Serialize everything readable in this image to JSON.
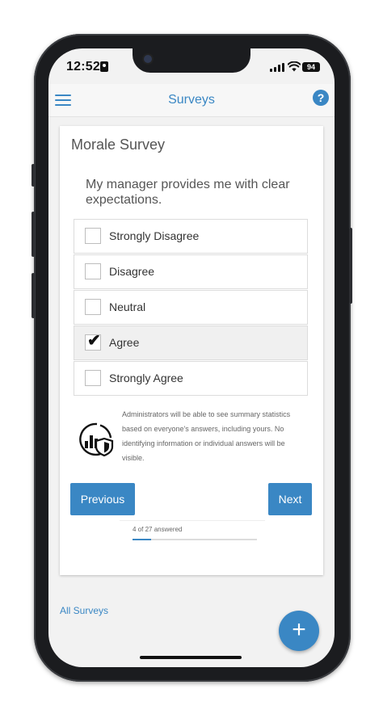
{
  "status_bar": {
    "time": "12:52",
    "battery": "94"
  },
  "header": {
    "title": "Surveys"
  },
  "survey": {
    "title": "Morale Survey",
    "question": "My manager provides me with clear expectations.",
    "options": [
      {
        "label": "Strongly Disagree",
        "selected": false
      },
      {
        "label": "Disagree",
        "selected": false
      },
      {
        "label": "Neutral",
        "selected": false
      },
      {
        "label": "Agree",
        "selected": true
      },
      {
        "label": "Strongly Agree",
        "selected": false
      }
    ],
    "privacy_note": "Administrators will be able to see summary statistics based on everyone's answers, including yours. No identifying information or individual answers will be visible."
  },
  "navigation": {
    "previous_label": "Previous",
    "next_label": "Next"
  },
  "progress": {
    "label": "4 of 27 answered",
    "answered": 4,
    "total": 27
  },
  "footer": {
    "all_surveys_label": "All Surveys",
    "fab_symbol": "+"
  },
  "colors": {
    "accent": "#3a87c4"
  }
}
